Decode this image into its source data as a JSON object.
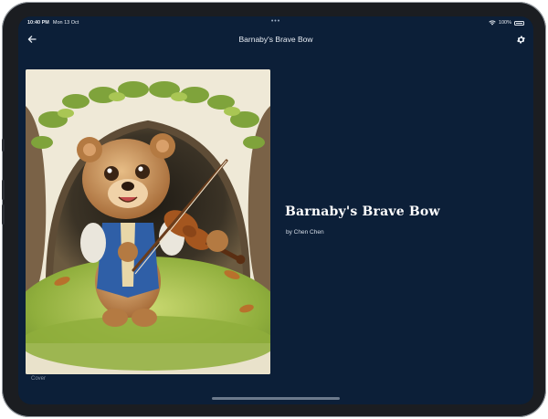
{
  "status_bar": {
    "time": "10:40 PM",
    "date": "Mon 13 Oct",
    "battery": "100%"
  },
  "app_bar": {
    "title": "Barnaby's Brave Bow",
    "back_icon": "arrow-left-icon",
    "settings_icon": "gear-icon"
  },
  "page": {
    "cover_caption": "Cover",
    "book_title": "Barnaby's Brave Bow",
    "author_line": "by Chen Chen"
  },
  "colors": {
    "background": "#0c1f38",
    "text": "#ffffff"
  }
}
